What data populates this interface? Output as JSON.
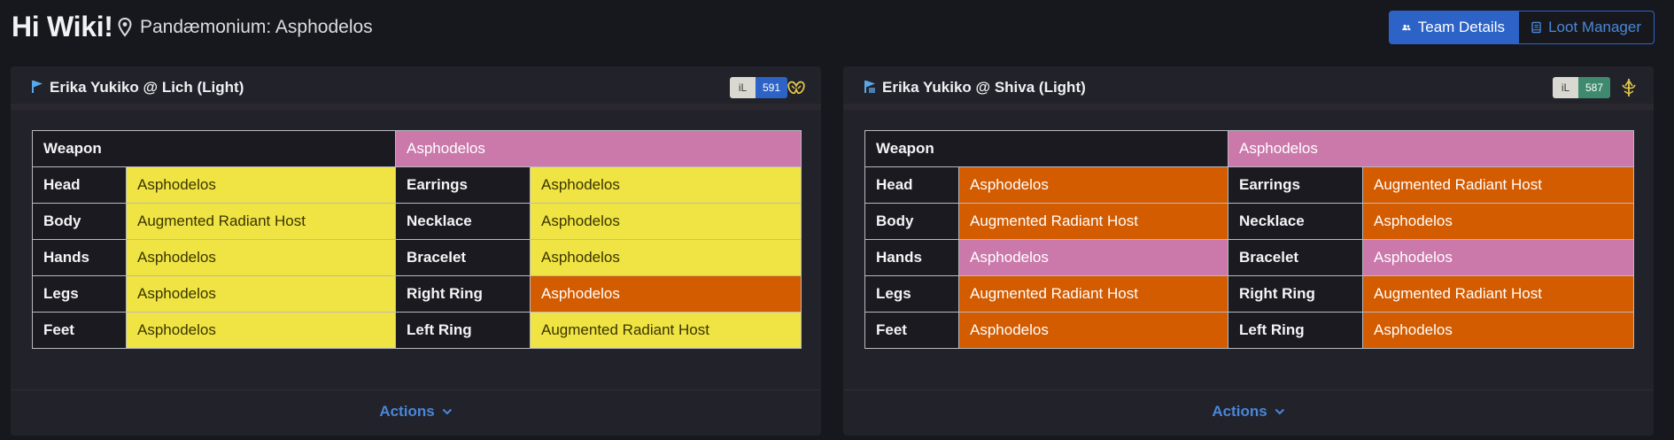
{
  "header": {
    "greeting": "Hi Wiki!",
    "location": "Pandæmonium: Asphodelos",
    "buttons": {
      "team_details": "Team Details",
      "loot_manager": "Loot Manager"
    }
  },
  "colors": {
    "bis_current": "#efe444",
    "bis_target": "#cb79ab",
    "needed": "#d35b00",
    "accent": "#2d63c7"
  },
  "cards": [
    {
      "title": "Erika Yukiko @ Lich (Light)",
      "il_key": "iL",
      "il_value": "591",
      "il_color": "#2d63c7",
      "job_icon": "summoner-icon",
      "rows": {
        "weapon": {
          "label": "Weapon",
          "value": "Asphodelos"
        },
        "head": {
          "label": "Head",
          "value": "Asphodelos"
        },
        "earrings": {
          "label": "Earrings",
          "value": "Asphodelos"
        },
        "body": {
          "label": "Body",
          "value": "Augmented Radiant Host"
        },
        "necklace": {
          "label": "Necklace",
          "value": "Asphodelos"
        },
        "hands": {
          "label": "Hands",
          "value": "Asphodelos"
        },
        "bracelet": {
          "label": "Bracelet",
          "value": "Asphodelos"
        },
        "legs": {
          "label": "Legs",
          "value": "Asphodelos"
        },
        "right_ring": {
          "label": "Right Ring",
          "value": "Asphodelos"
        },
        "feet": {
          "label": "Feet",
          "value": "Asphodelos"
        },
        "left_ring": {
          "label": "Left Ring",
          "value": "Augmented Radiant Host"
        }
      },
      "actions": "Actions"
    },
    {
      "title": "Erika Yukiko @ Shiva (Light)",
      "il_key": "iL",
      "il_value": "587",
      "il_color": "#3f8a6e",
      "job_icon": "sage-icon",
      "rows": {
        "weapon": {
          "label": "Weapon",
          "value": "Asphodelos"
        },
        "head": {
          "label": "Head",
          "value": "Asphodelos"
        },
        "earrings": {
          "label": "Earrings",
          "value": "Augmented Radiant Host"
        },
        "body": {
          "label": "Body",
          "value": "Augmented Radiant Host"
        },
        "necklace": {
          "label": "Necklace",
          "value": "Asphodelos"
        },
        "hands": {
          "label": "Hands",
          "value": "Asphodelos"
        },
        "bracelet": {
          "label": "Bracelet",
          "value": "Asphodelos"
        },
        "legs": {
          "label": "Legs",
          "value": "Augmented Radiant Host"
        },
        "right_ring": {
          "label": "Right Ring",
          "value": "Augmented Radiant Host"
        },
        "feet": {
          "label": "Feet",
          "value": "Asphodelos"
        },
        "left_ring": {
          "label": "Left Ring",
          "value": "Asphodelos"
        }
      },
      "actions": "Actions"
    }
  ]
}
